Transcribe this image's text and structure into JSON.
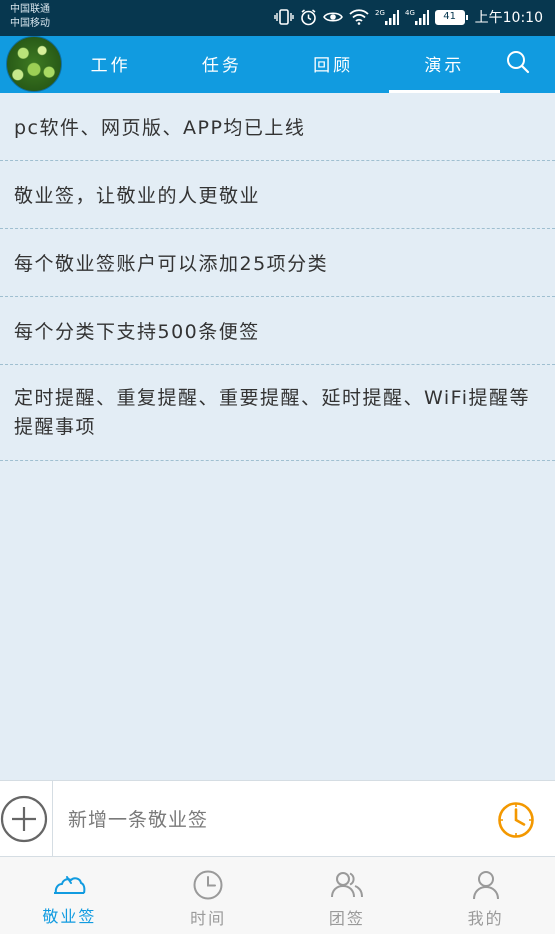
{
  "status_bar": {
    "carrier_1": "中国联通",
    "carrier_2": "中国移动",
    "battery": "41",
    "time": "上午10:10"
  },
  "header": {
    "tabs": [
      {
        "label": "工作",
        "active": false
      },
      {
        "label": "任务",
        "active": false
      },
      {
        "label": "回顾",
        "active": false
      },
      {
        "label": "演示",
        "active": true
      }
    ],
    "search_icon": "search-icon"
  },
  "notes": [
    "pc软件、网页版、APP均已上线",
    "敬业签，让敬业的人更敬业",
    "每个敬业签账户可以添加25项分类",
    "每个分类下支持500条便签",
    "定时提醒、重复提醒、重要提醒、延时提醒、WiFi提醒等提醒事项"
  ],
  "composer": {
    "placeholder": "新增一条敬业签",
    "add_icon": "plus-circle-icon",
    "reminder_icon": "clock-icon"
  },
  "bottom_nav": [
    {
      "label": "敬业签",
      "icon": "cloud-hand-icon",
      "active": true
    },
    {
      "label": "时间",
      "icon": "clock-icon",
      "active": false
    },
    {
      "label": "团签",
      "icon": "group-icon",
      "active": false
    },
    {
      "label": "我的",
      "icon": "person-icon",
      "active": false
    }
  ],
  "colors": {
    "status_bar": "#07374f",
    "header": "#119be0",
    "background": "#e3edf5",
    "accent_orange": "#f39800",
    "active_nav": "#119be0"
  }
}
